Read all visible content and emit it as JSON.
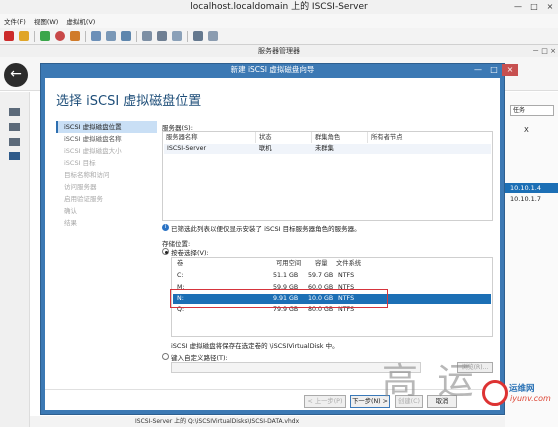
{
  "vm_window": {
    "title": "localhost.localdomain 上的 ISCSI-Server",
    "menus": [
      "文件(F)",
      "视图(W)",
      "虚拟机(V)"
    ],
    "controls": [
      "—",
      "□",
      "×"
    ]
  },
  "host": {
    "title": "服务器管理器",
    "controls": "－ □ ×",
    "task_label": "任务",
    "ip1": "10.10.1.4",
    "ip2": "10.10.1.7",
    "status_path": "ISCSI-Server 上的 Q:\\iSCSIVirtualDisks\\ISCSI-DATA.vhdx",
    "x_mark": "X"
  },
  "wizard": {
    "title": "新建 iSCSI 虚拟磁盘向导",
    "heading": "选择 iSCSI 虚拟磁盘位置",
    "steps": [
      "iSCSI 虚拟磁盘位置",
      "iSCSI 虚拟磁盘名称",
      "iSCSI 虚拟磁盘大小",
      "iSCSI 目标",
      "目标名称和访问",
      "访问服务器",
      "启用验证服务",
      "确认",
      "结果"
    ],
    "server_label": "服务器(S):",
    "server_headers": [
      "服务器名称",
      "状态",
      "群集角色",
      "所有者节点"
    ],
    "server_row": [
      "ISCSI-Server",
      "联机",
      "未群集",
      ""
    ],
    "info_text": "已筛选此列表以便仅显示安装了 iSCSI 目标服务器角色的服务器。",
    "location_label": "存储位置:",
    "by_volume_label": "按卷选择(V):",
    "vol_headers": [
      "卷",
      "可用空间",
      "容量",
      "文件系统"
    ],
    "volumes": [
      {
        "vol": "C:",
        "free": "51.1 GB",
        "cap": "59.7 GB",
        "fs": "NTFS"
      },
      {
        "vol": "M:",
        "free": "59.9 GB",
        "cap": "60.0 GB",
        "fs": "NTFS"
      },
      {
        "vol": "N:",
        "free": "9.91 GB",
        "cap": "10.0 GB",
        "fs": "NTFS"
      },
      {
        "vol": "Q:",
        "free": "79.9 GB",
        "cap": "80.0 GB",
        "fs": "NTFS"
      }
    ],
    "save_note": "iSCSI 虚拟磁盘将保存在选定卷的 \\iSCSIVirtualDisk 中。",
    "custom_path_label": "键入自定义路径(T):",
    "browse": "浏览(R)...",
    "buttons": {
      "prev": "< 上一步(P)",
      "next": "下一步(N) >",
      "create": "创建(C)",
      "cancel": "取消"
    }
  },
  "watermark": {
    "big": "高 运",
    "site": "运维网",
    "url": "iyunv.com"
  }
}
